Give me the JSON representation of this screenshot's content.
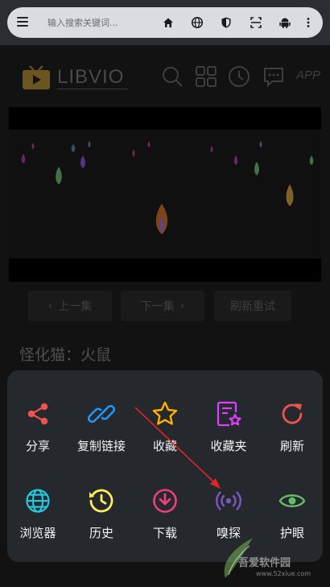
{
  "browser": {
    "url_placeholder": "输入搜索关键词...",
    "icons": [
      "menu-icon",
      "home-icon",
      "globe-icon",
      "shield-icon",
      "scan-icon",
      "android-icon",
      "more-vert-icon"
    ]
  },
  "site": {
    "logo_text": "LIBVIO",
    "app_link": "APP",
    "icons": [
      "search-icon",
      "grid-icon",
      "clock-icon",
      "message-icon"
    ]
  },
  "episode": {
    "prev_label": "上一集",
    "next_label": "下一集",
    "refresh_label": "刷新重试",
    "prev_chevron": "‹",
    "next_chevron": "›",
    "title": "怪化猫：火鼠"
  },
  "menu": {
    "items": [
      {
        "label": "分享",
        "icon": "share-icon",
        "color": "#ef5350"
      },
      {
        "label": "复制链接",
        "icon": "link-icon",
        "color": "#2196f3"
      },
      {
        "label": "收藏",
        "icon": "star-icon",
        "color": "#ffb300"
      },
      {
        "label": "收藏夹",
        "icon": "bookmark-list-icon",
        "color": "#e040fb"
      },
      {
        "label": "刷新",
        "icon": "refresh-icon",
        "color": "#ef5350"
      },
      {
        "label": "浏览器",
        "icon": "globe-icon",
        "color": "#26c6da"
      },
      {
        "label": "历史",
        "icon": "history-icon",
        "color": "#ffee58"
      },
      {
        "label": "下载",
        "icon": "download-icon",
        "color": "#ec407a"
      },
      {
        "label": "嗅探",
        "icon": "sniff-icon",
        "color": "#7e57c2"
      },
      {
        "label": "护眼",
        "icon": "eye-icon",
        "color": "#66bb6a"
      }
    ]
  },
  "watermark": {
    "name": "吾爱软件园",
    "url": "www.52xiue.com"
  }
}
